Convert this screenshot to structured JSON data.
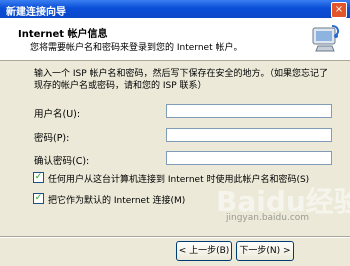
{
  "window": {
    "title": "新建连接向导",
    "close_glyph": "×"
  },
  "header": {
    "title": "Internet 帐户信息",
    "subtitle": "您将需要帐户名和密码来登录到您的 Internet 帐户。",
    "icon": "dialup-connection-icon"
  },
  "intro_text": "输入一个 ISP 帐户名和密码，然后写下保存在安全的地方。（如果您忘记了现存的帐户名或密码，请和您的 ISP 联系）",
  "fields": {
    "username": {
      "label": "用户名(U):",
      "value": ""
    },
    "password": {
      "label": "密码(P):",
      "value": ""
    },
    "confirm": {
      "label": "确认密码(C):",
      "value": ""
    }
  },
  "checkboxes": {
    "any_user": {
      "label": "任何用户从这台计算机连接到 Internet 时使用此帐户名和密码(S)",
      "checked": true
    },
    "default_conn": {
      "label": "把它作为默认的 Internet 连接(M)",
      "checked": true
    }
  },
  "buttons": {
    "back": "< 上一步(B)",
    "next": "下一步(N) >"
  },
  "watermark": {
    "brand": "Baidu经验",
    "url": "jingyan.baidu.com"
  },
  "colors": {
    "titlebar": "#0a4fd8",
    "dialog_bg": "#ece9d8",
    "check": "#21a121"
  }
}
